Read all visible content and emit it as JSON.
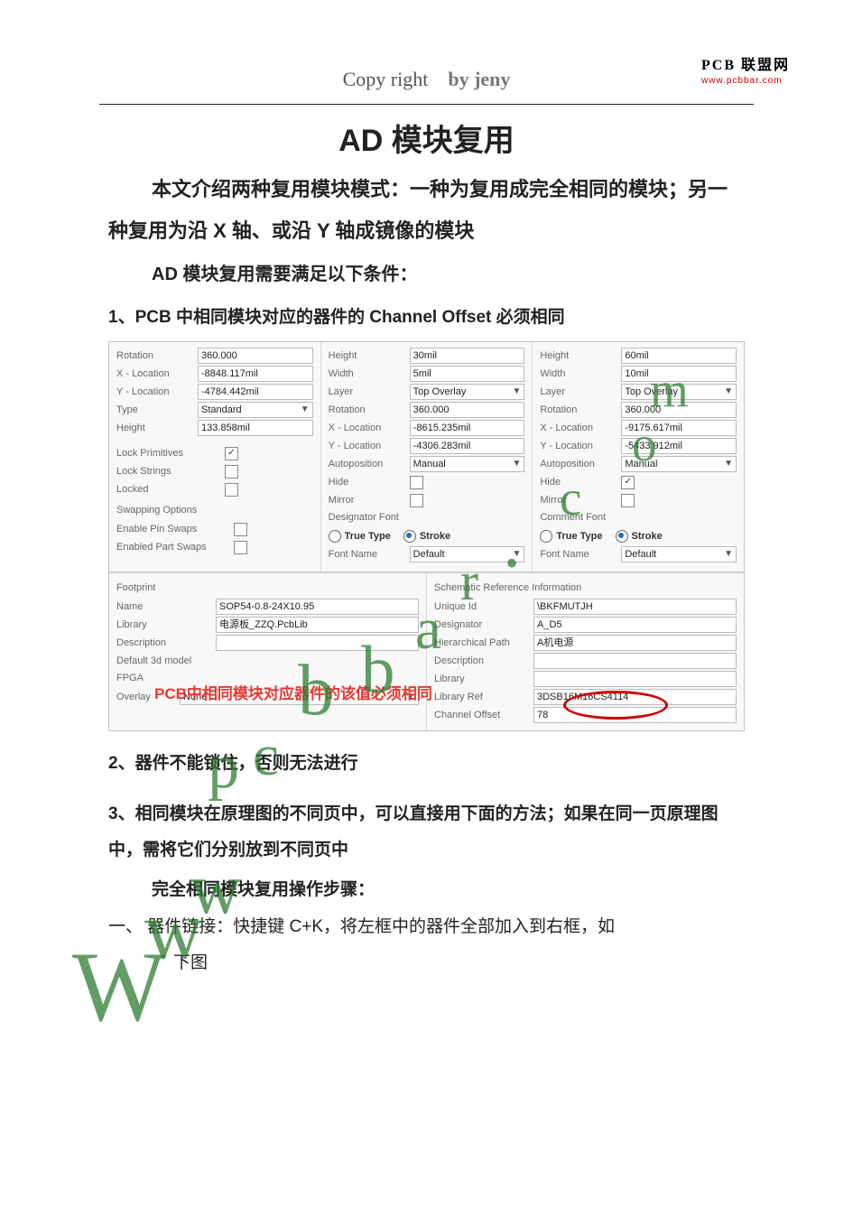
{
  "brand": {
    "line1": "PCB 联盟网",
    "line2": "www.pcbbar.com"
  },
  "header": {
    "copy": "Copy right",
    "by": "by jeny"
  },
  "title": "AD 模块复用",
  "intro": "本文介绍两种复用模块模式：一种为复用成完全相同的模块；另一种复用为沿 X 轴、或沿 Y 轴成镜像的模块",
  "cond_title": "AD 模块复用需要满足以下条件：",
  "conds": {
    "c1": "1、PCB 中相同模块对应的器件的 Channel Offset 必须相同",
    "c2": "2、器件不能锁住，否则无法进行",
    "c3": "3、相同模块在原理图的不同页中，可以直接用下面的方法；如果在同一页原理图中，需将它们分别放到不同页中"
  },
  "steps_title": "完全相同模块复用操作步骤：",
  "step1_a": "一、  器件链接：快捷键 C+K，将左框中的器件全部加入到右框，如",
  "step1_b": "下图",
  "panel": {
    "col_left": {
      "rotation_lbl": "Rotation",
      "rotation": "360.000",
      "xloc_lbl": "X - Location",
      "xloc": "-8848.117mil",
      "yloc_lbl": "Y - Location",
      "yloc": "-4784.442mil",
      "type_lbl": "Type",
      "type": "Standard",
      "height_lbl": "Height",
      "height": "133.858mil",
      "lockprim_lbl": "Lock Primitives",
      "lockprim": true,
      "lockstr_lbl": "Lock Strings",
      "lockstr": false,
      "locked_lbl": "Locked",
      "locked": false,
      "swap_title": "Swapping Options",
      "pinswap_lbl": "Enable Pin Swaps",
      "pinswap": false,
      "partswap_lbl": "Enabled Part Swaps",
      "partswap": false
    },
    "col_mid": {
      "height_lbl": "Height",
      "height": "30mil",
      "width_lbl": "Width",
      "width": "5mil",
      "layer_lbl": "Layer",
      "layer": "Top Overlay",
      "rotation_lbl": "Rotation",
      "rotation": "360.000",
      "xloc_lbl": "X - Location",
      "xloc": "-8615.235mil",
      "yloc_lbl": "Y - Location",
      "yloc": "-4306.283mil",
      "autopos_lbl": "Autoposition",
      "autopos": "Manual",
      "hide_lbl": "Hide",
      "hide": false,
      "mirror_lbl": "Mirror",
      "mirror": false,
      "font_title": "Designator Font",
      "tt_lbl": "True Type",
      "stroke_lbl": "Stroke",
      "fontname_lbl": "Font Name",
      "fontname": "Default"
    },
    "col_right": {
      "height_lbl": "Height",
      "height": "60mil",
      "width_lbl": "Width",
      "width": "10mil",
      "layer_lbl": "Layer",
      "layer": "Top Overlay",
      "rotation_lbl": "Rotation",
      "rotation": "360.000",
      "xloc_lbl": "X - Location",
      "xloc": "-9175.617mil",
      "yloc_lbl": "Y - Location",
      "yloc": "-5433.912mil",
      "autopos_lbl": "Autoposition",
      "autopos": "Manual",
      "hide_lbl": "Hide",
      "hide": true,
      "mirror_lbl": "Mirror",
      "mirror": false,
      "font_title": "Comment Font",
      "tt_lbl": "True Type",
      "stroke_lbl": "Stroke",
      "fontname_lbl": "Font Name",
      "fontname": "Default"
    },
    "lower_left": {
      "title": "Footprint",
      "name_lbl": "Name",
      "name": "SOP54-0.8-24X10.95",
      "library_lbl": "Library",
      "library": "电源板_ZZQ.PcbLib",
      "desc_lbl": "Description",
      "desc": "",
      "d3d_lbl": "Default 3d model",
      "d3d": "",
      "fpga_title": "FPGA",
      "overlay_lbl": "Overlay",
      "overlay": "None"
    },
    "lower_right": {
      "title": "Schematic Reference Information",
      "uid_lbl": "Unique Id",
      "uid": "\\BKFMUTJH",
      "desig_lbl": "Designator",
      "desig": "A_D5",
      "hpath_lbl": "Hierarchical Path",
      "hpath": "A机电源",
      "desc_lbl": "Description",
      "desc": "",
      "lib_lbl": "Library",
      "lib": "",
      "libref_lbl": "Library Ref",
      "libref": "3DSB16M16CS4114",
      "choff_lbl": "Channel Offset",
      "choff": "78"
    },
    "note": "PCB中相同模块对应器件的该值必须相同"
  },
  "wm_letters": {
    "W": "W",
    "w": "w",
    "p": "p",
    "c": "c",
    "b": "b",
    "a": "a",
    "r": "r",
    "dot": "•",
    "o": "o",
    "m": "m"
  }
}
